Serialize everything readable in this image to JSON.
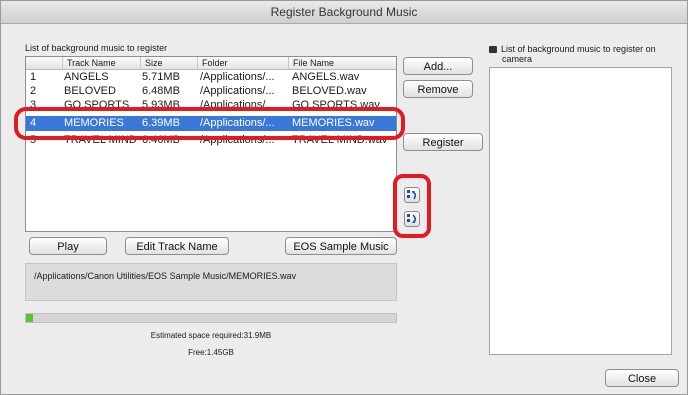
{
  "window": {
    "title": "Register Background Music"
  },
  "left_panel": {
    "label": "List of background music to register"
  },
  "table": {
    "columns": [
      "",
      "Track Name",
      "Size",
      "Folder",
      "File Name"
    ],
    "rows": [
      {
        "num": "1",
        "track": "ANGELS",
        "size": "5.71MB",
        "folder": "/Applications/...",
        "file": "ANGELS.wav"
      },
      {
        "num": "2",
        "track": "BELOVED",
        "size": "6.48MB",
        "folder": "/Applications/...",
        "file": "BELOVED.wav"
      },
      {
        "num": "3",
        "track": "GO SPORTS",
        "size": "5.93MB",
        "folder": "/Applications/...",
        "file": "GO SPORTS.wav"
      },
      {
        "num": "4",
        "track": "MEMORIES",
        "size": "6.39MB",
        "folder": "/Applications/...",
        "file": "MEMORIES.wav"
      },
      {
        "num": "5",
        "track": "TRAVEL MIND",
        "size": "6.46MB",
        "folder": "/Applications/...",
        "file": "TRAVEL MIND.wav"
      }
    ],
    "selected_index": 3
  },
  "buttons": {
    "add": "Add...",
    "remove": "Remove",
    "register": "Register",
    "play": "Play",
    "edit_track_name": "Edit Track Name",
    "eos_sample_music": "EOS Sample Music",
    "close": "Close"
  },
  "icons": {
    "move_up": "move-up-icon",
    "move_down": "move-down-icon",
    "camera": "camera-icon"
  },
  "path_display": "/Applications/Canon Utilities/EOS Sample Music/MEMORIES.wav",
  "progress": {
    "fraction": 0.02,
    "color": "#58c437"
  },
  "space": {
    "estimated": "Estimated space required:31.9MB",
    "free": "Free:1.45GB"
  },
  "right_panel": {
    "label_line1": "List of background music to register on",
    "label_line2": "camera"
  },
  "highlight_color": "#e21a22"
}
